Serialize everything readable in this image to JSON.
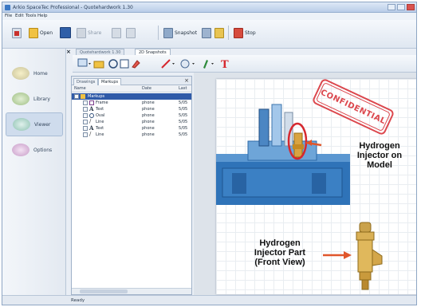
{
  "window": {
    "title": "Arkio SpaceTec Professional - Quotehardwork 1.30"
  },
  "menu": [
    "File",
    "Edit",
    "Tools",
    "Help"
  ],
  "toolbar": {
    "items": [
      {
        "label": "",
        "icon": "pdf-icon"
      },
      {
        "label": "Open",
        "icon": "open-folder-icon"
      },
      {
        "label": "",
        "icon": "save-icon"
      },
      {
        "label": "Share",
        "icon": "share-icon"
      },
      {
        "label": "",
        "icon": "print-icon"
      },
      {
        "label": "Snapshot",
        "icon": "snapshot-icon"
      },
      {
        "label": "Stop",
        "icon": "stop-icon"
      }
    ]
  },
  "sidebar": {
    "items": [
      {
        "label": "Home",
        "icon": "home-icon",
        "active": false
      },
      {
        "label": "Library",
        "icon": "library-icon",
        "active": false
      },
      {
        "label": "Viewer",
        "icon": "viewer-icon",
        "active": true
      },
      {
        "label": "Options",
        "icon": "options-icon",
        "active": false
      }
    ]
  },
  "content_tabs": [
    {
      "label": "Quotehardwork 1.30",
      "active": false
    },
    {
      "label": "2D Snapshots",
      "active": true
    }
  ],
  "panel": {
    "tabs": [
      {
        "label": "Drawings",
        "active": false
      },
      {
        "label": "Markups",
        "active": true
      }
    ],
    "columns": [
      "Name",
      "Date",
      "Last"
    ],
    "rows": [
      {
        "name": "Markups",
        "date": "",
        "last": "",
        "icon": "folder-icon",
        "selected": true
      },
      {
        "name": "Frame",
        "date": "phone",
        "last": "5/05",
        "icon": "frame-icon",
        "selected": false
      },
      {
        "name": "Text",
        "date": "phone",
        "last": "5/05",
        "icon": "text-icon",
        "selected": false
      },
      {
        "name": "Oval",
        "date": "phone",
        "last": "5/05",
        "icon": "oval-icon",
        "selected": false
      },
      {
        "name": "Line",
        "date": "phone",
        "last": "5/05",
        "icon": "line-icon",
        "selected": false
      },
      {
        "name": "Text",
        "date": "phone",
        "last": "5/05",
        "icon": "text-icon",
        "selected": false
      },
      {
        "name": "Line",
        "date": "phone",
        "last": "5/05",
        "icon": "line-icon",
        "selected": false
      }
    ]
  },
  "canvas": {
    "stamp": "CONFIDENTIAL",
    "callout_model": [
      "Hydrogen",
      "Injector on",
      "Model"
    ],
    "callout_part": [
      "Hydrogen",
      "Injector Part",
      "(Front View)"
    ],
    "colors": {
      "markup_red": "#d6282f",
      "model_blue": "#2f73b8",
      "brass": "#d9a441"
    }
  },
  "status": {
    "text": "Ready"
  }
}
